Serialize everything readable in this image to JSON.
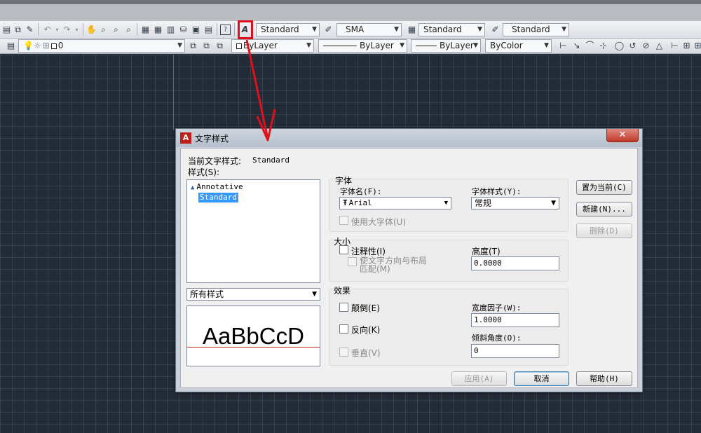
{
  "toolbar1": {
    "text_style": "Standard",
    "dim_style": "SMA",
    "table_style": "Standard",
    "mleader_style": "Standard"
  },
  "toolbar2": {
    "layer": "0",
    "color": "ByLayer",
    "linetype": "ByLayer",
    "lineweight": "ByLayer",
    "plotstyle": "ByColor"
  },
  "dialog": {
    "title": "文字样式",
    "current_label": "当前文字样式:",
    "current_value": "Standard",
    "styles_label": "样式(S):",
    "styles": [
      {
        "name": "Annotative",
        "annotative": true,
        "selected": false
      },
      {
        "name": "Standard",
        "annotative": false,
        "selected": true
      }
    ],
    "filter_value": "所有样式",
    "preview_text": "AaBbCcD",
    "font_group": "字体",
    "font_name_label": "字体名(F):",
    "font_name_value": "Arial",
    "font_style_label": "字体样式(Y):",
    "font_style_value": "常规",
    "bigfont_label": "使用大字体(U)",
    "size_group": "大小",
    "annotative_label": "注释性(I)",
    "match_orientation_label_1": "使文字方向与布局",
    "match_orientation_label_2": "匹配(M)",
    "height_label": "高度(T)",
    "height_value": "0.0000",
    "effects_group": "效果",
    "upside_down_label": "颠倒(E)",
    "backwards_label": "反向(K)",
    "vertical_label": "垂直(V)",
    "width_factor_label": "宽度因子(W):",
    "width_factor_value": "1.0000",
    "oblique_label": "倾斜角度(O):",
    "oblique_value": "0",
    "set_current_btn": "置为当前(C)",
    "new_btn": "新建(N)...",
    "delete_btn": "删除(D)",
    "apply_btn": "应用(A)",
    "cancel_btn": "取消",
    "help_btn": "帮助(H)"
  },
  "colors": {
    "highlight": "#e0101a",
    "selection": "#3399ff",
    "canvas": "#232b37"
  }
}
